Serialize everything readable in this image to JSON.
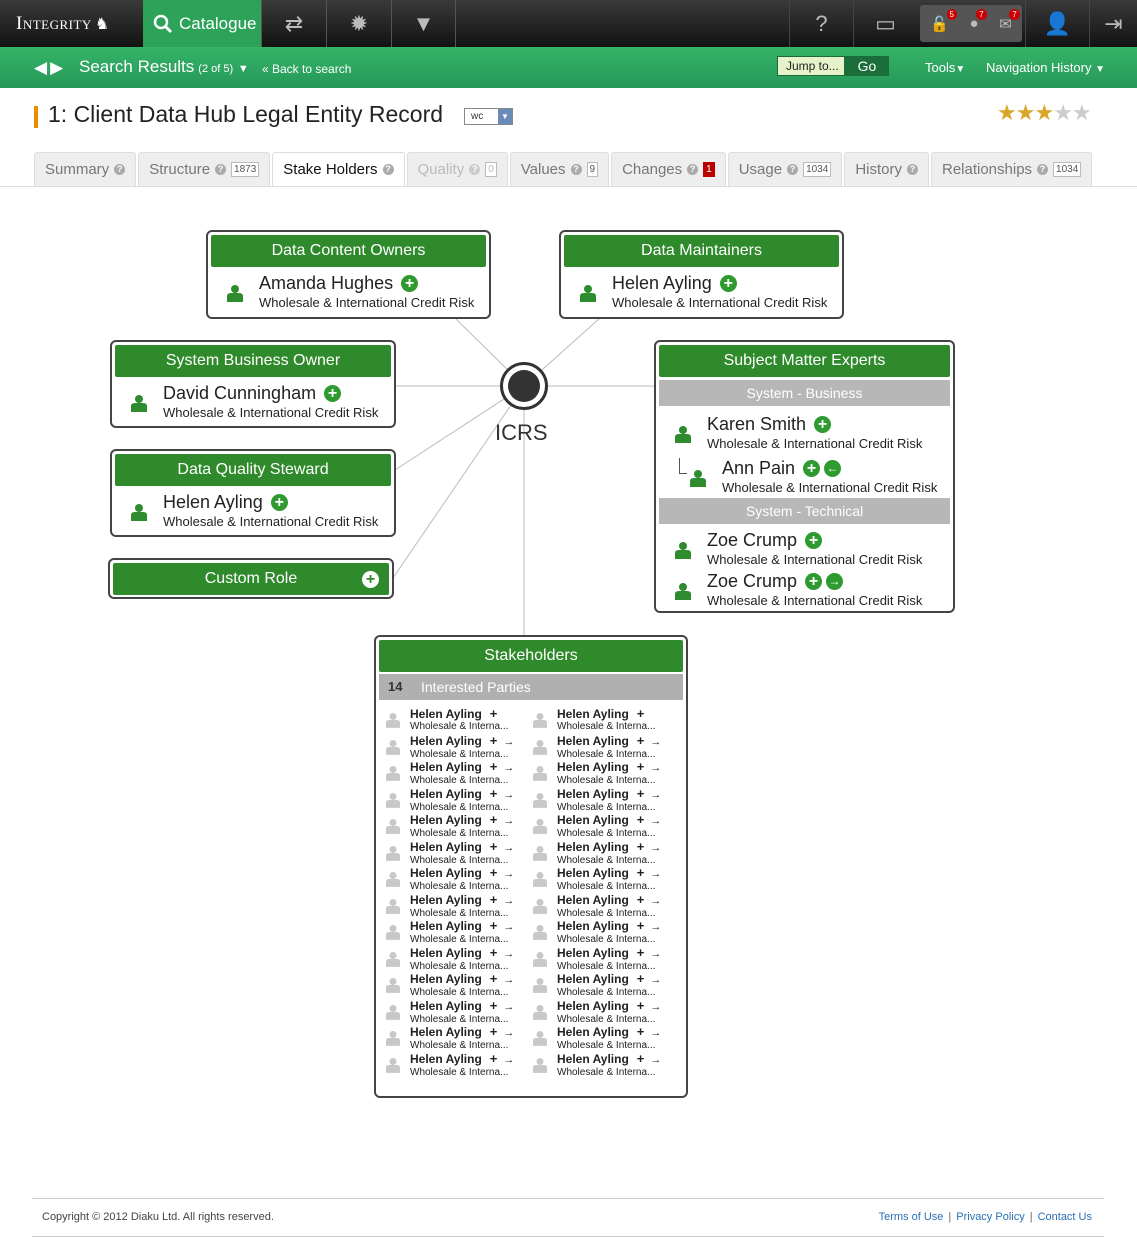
{
  "topbar": {
    "brand": "Integrity",
    "catalogue": "Catalogue",
    "notifications": [
      {
        "icon": "lock-icon",
        "count": "5"
      },
      {
        "icon": "chat-icon",
        "count": "7"
      },
      {
        "icon": "mail-icon",
        "count": "7"
      }
    ]
  },
  "subbar": {
    "search_results": "Search Results",
    "count": "(2 of 5)",
    "back": "« Back to search",
    "jump_placeholder": "Jump to...",
    "go": "Go",
    "tools": "Tools",
    "nav_history": "Navigation History"
  },
  "record": {
    "title": "1: Client Data Hub Legal Entity Record",
    "badge": "wc",
    "rating": 3,
    "rating_max": 5
  },
  "tabs": [
    {
      "label": "Summary",
      "count": ""
    },
    {
      "label": "Structure",
      "count": "1873"
    },
    {
      "label": "Stake Holders",
      "count": ""
    },
    {
      "label": "Quality",
      "count": "0"
    },
    {
      "label": "Values",
      "count": "9"
    },
    {
      "label": "Changes",
      "count": "1"
    },
    {
      "label": "Usage",
      "count": "1034"
    },
    {
      "label": "History",
      "count": ""
    },
    {
      "label": "Relationships",
      "count": "1034"
    }
  ],
  "hub": {
    "label": "ICRS"
  },
  "roles": {
    "content_owners": {
      "title": "Data Content Owners",
      "name": "Amanda Hughes",
      "org": "Wholesale & International Credit Risk"
    },
    "maintainers": {
      "title": "Data Maintainers",
      "name": "Helen Ayling",
      "org": "Wholesale & International Credit Risk"
    },
    "business_owner": {
      "title": "System Business Owner",
      "name": "David Cunningham",
      "org": "Wholesale & International Credit Risk"
    },
    "quality_steward": {
      "title": "Data Quality Steward",
      "name": "Helen Ayling",
      "org": "Wholesale & International Credit Risk"
    },
    "custom_role": {
      "title": "Custom Role"
    },
    "sme": {
      "title": "Subject Matter Experts",
      "business_label": "System - Business",
      "technical_label": "System - Technical",
      "business": [
        {
          "name": "Karen Smith",
          "org": "Wholesale & International Credit Risk"
        },
        {
          "name": "Ann Pain",
          "org": "Wholesale & International Credit Risk"
        }
      ],
      "technical": [
        {
          "name": "Zoe Crump",
          "org": "Wholesale & International Credit Risk"
        },
        {
          "name": "Zoe Crump",
          "org": "Wholesale & International Credit Risk"
        }
      ]
    },
    "stakeholders": {
      "title": "Stakeholders",
      "count": "14",
      "interested": "Interested Parties",
      "entry_name": "Helen Ayling",
      "entry_org": "Wholesale & Interna..."
    }
  },
  "footer": {
    "copyright": "Copyright © 2012 Diaku Ltd. All rights reserved.",
    "terms": "Terms of Use",
    "privacy": "Privacy Policy",
    "contact": "Contact Us"
  }
}
